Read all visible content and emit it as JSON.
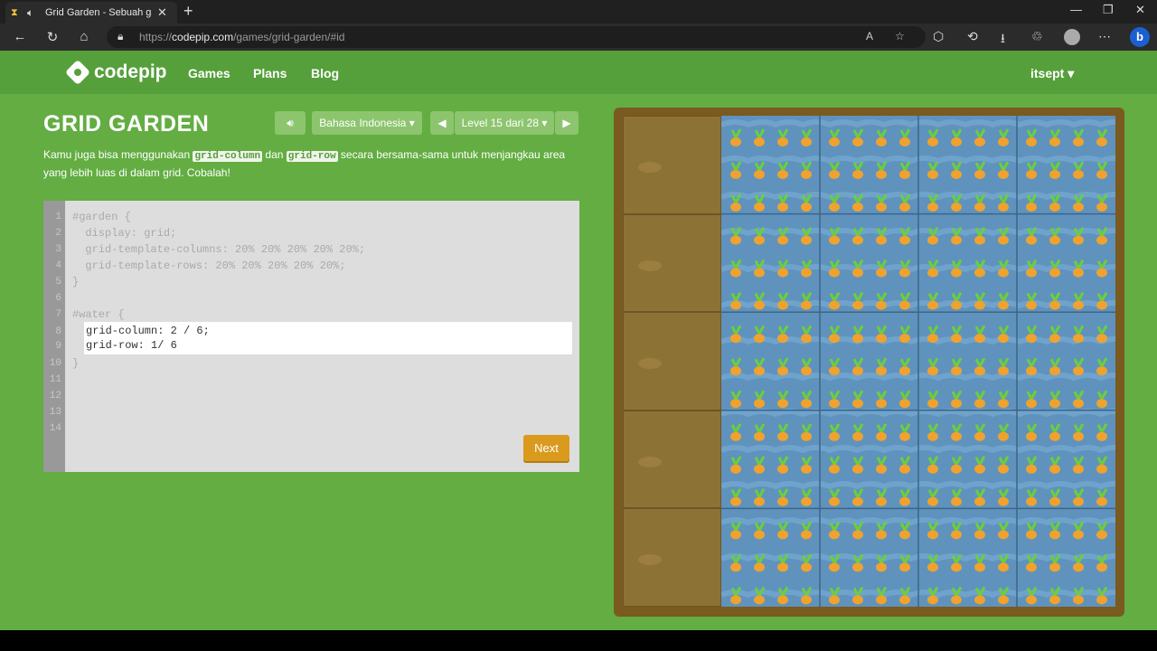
{
  "browser": {
    "tab_title": "Grid Garden - Sebuah game",
    "url_prefix": "https://",
    "url_domain": "codepip.com",
    "url_path": "/games/grid-garden/#id"
  },
  "site": {
    "logo": "codepip",
    "nav": [
      "Games",
      "Plans",
      "Blog"
    ],
    "user": "itsept"
  },
  "game": {
    "title": "GRID GARDEN",
    "language": "Bahasa Indonesia",
    "level": "Level 15 dari 28",
    "description_parts": [
      "Kamu juga bisa menggunakan ",
      "grid-column",
      " dan ",
      "grid-row",
      " secara bersama-sama untuk menjangkau area yang lebih luas di dalam grid. Cobalah!"
    ],
    "line_numbers": [
      "1",
      "2",
      "3",
      "4",
      "5",
      "6",
      "7",
      "8",
      "9",
      "10",
      "11",
      "12",
      "13",
      "14"
    ],
    "code_lines": [
      "#garden {",
      "  display: grid;",
      "  grid-template-columns: 20% 20% 20% 20% 20%;",
      "  grid-template-rows: 20% 20% 20% 20% 20%;",
      "}",
      "",
      "#water {"
    ],
    "input_lines": [
      "grid-column: 2 / 6;",
      "grid-row: 1/ 6"
    ],
    "closing_brace": "}",
    "next_label": "Next"
  }
}
